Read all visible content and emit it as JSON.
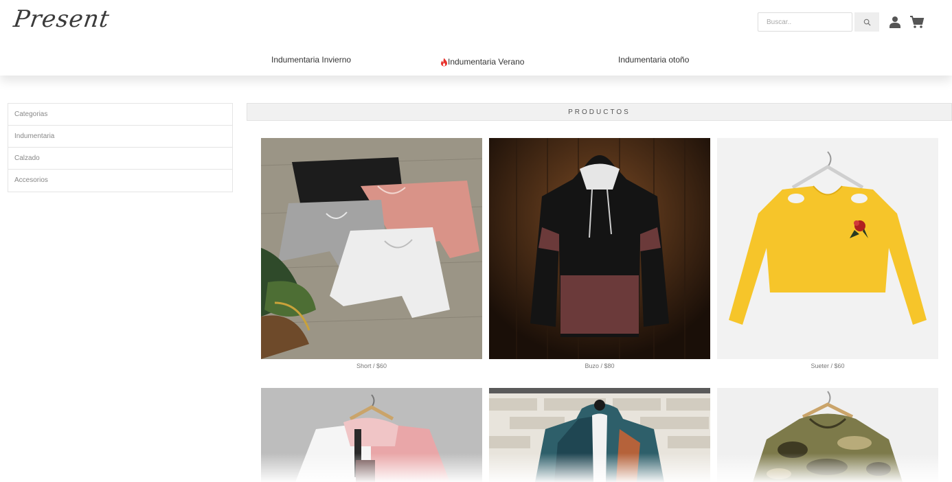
{
  "header": {
    "logo": "Present",
    "search_placeholder": "Buscar..",
    "nav": [
      "Indumentaria Invierno",
      "Indumentaria Verano",
      "Indumentaria otoño"
    ]
  },
  "sidebar": {
    "items": [
      "Categorias",
      "Indumentaria",
      "Calzado",
      "Accesorios"
    ]
  },
  "products": {
    "title": "PRODUCTOS",
    "items": [
      {
        "caption": "Short / $60"
      },
      {
        "caption": "Buzo / $80"
      },
      {
        "caption": "Sueter / $60"
      }
    ]
  },
  "colors": {
    "accent_fire": "#e8322c",
    "icon_gray": "#555555"
  }
}
